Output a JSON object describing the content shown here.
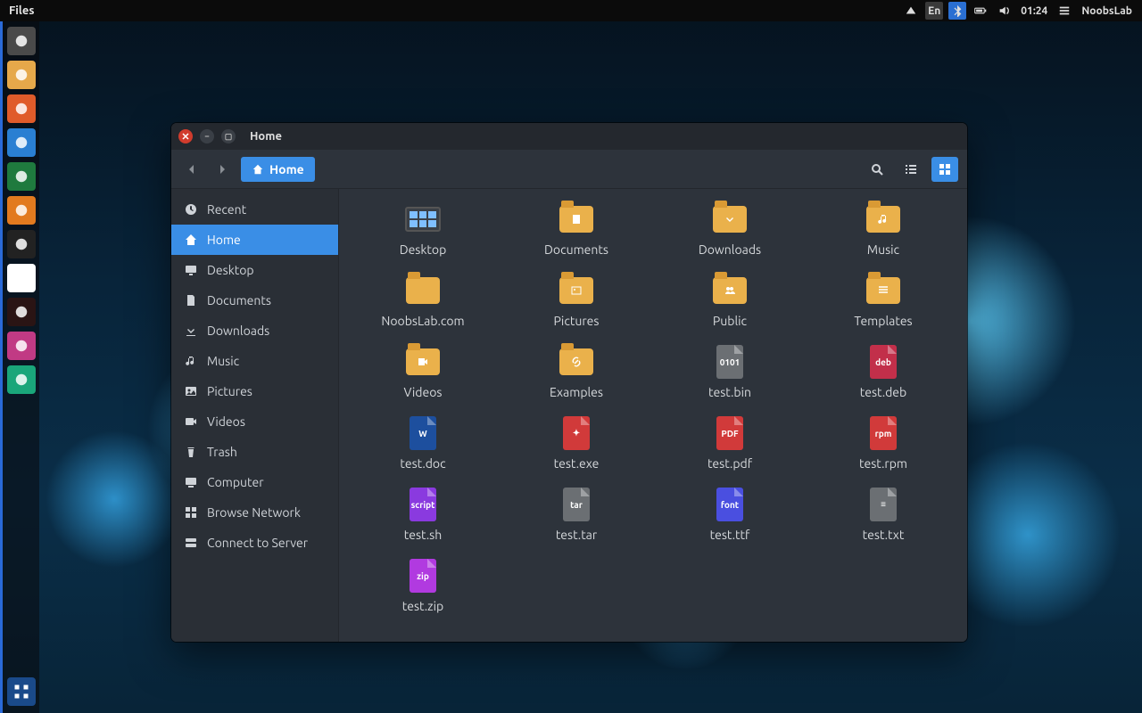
{
  "panel": {
    "app_label": "Files",
    "clock": "01:24",
    "lang": "En",
    "user_label": "NoobsLab"
  },
  "launchers": [
    {
      "name": "ubuntu-logo",
      "bg": "#4a4a4a"
    },
    {
      "name": "files-icon",
      "bg": "#e6a84a"
    },
    {
      "name": "firefox-icon",
      "bg": "#e05b2a"
    },
    {
      "name": "software-icon",
      "bg": "#2a7fd2"
    },
    {
      "name": "calendar-icon",
      "bg": "#1f7a3e"
    },
    {
      "name": "charts-icon",
      "bg": "#e27a1f"
    },
    {
      "name": "updater-icon",
      "bg": "#222"
    },
    {
      "name": "amazon-icon",
      "bg": "#fff"
    },
    {
      "name": "record-icon",
      "bg": "#2a1414"
    },
    {
      "name": "settings-icon",
      "bg": "#c13a84"
    },
    {
      "name": "shield-icon",
      "bg": "#1aa67a"
    }
  ],
  "window": {
    "title": "Home",
    "path_label": "Home",
    "sidebar": [
      {
        "icon": "clock",
        "label": "Recent"
      },
      {
        "icon": "home",
        "label": "Home",
        "active": true
      },
      {
        "icon": "desktop",
        "label": "Desktop"
      },
      {
        "icon": "docs",
        "label": "Documents"
      },
      {
        "icon": "download",
        "label": "Downloads"
      },
      {
        "icon": "music",
        "label": "Music"
      },
      {
        "icon": "pictures",
        "label": "Pictures"
      },
      {
        "icon": "videos",
        "label": "Videos"
      },
      {
        "icon": "trash",
        "label": "Trash"
      },
      {
        "icon": "computer",
        "label": "Computer"
      },
      {
        "icon": "network",
        "label": "Browse Network"
      },
      {
        "icon": "server",
        "label": "Connect to Server"
      }
    ],
    "files": [
      {
        "name": "Desktop",
        "kind": "desktop"
      },
      {
        "name": "Documents",
        "kind": "folder",
        "sym": "docs"
      },
      {
        "name": "Downloads",
        "kind": "folder",
        "sym": "download"
      },
      {
        "name": "Music",
        "kind": "folder",
        "sym": "music"
      },
      {
        "name": "NoobsLab.com",
        "kind": "folder"
      },
      {
        "name": "Pictures",
        "kind": "folder",
        "sym": "pictures"
      },
      {
        "name": "Public",
        "kind": "folder",
        "sym": "public"
      },
      {
        "name": "Templates",
        "kind": "folder",
        "sym": "templates"
      },
      {
        "name": "Videos",
        "kind": "folder",
        "sym": "videos"
      },
      {
        "name": "Examples",
        "kind": "folder",
        "sym": "link"
      },
      {
        "name": "test.bin",
        "kind": "file",
        "bg": "#6b6f73",
        "tag": "0101"
      },
      {
        "name": "test.deb",
        "kind": "file",
        "bg": "#c22f4a",
        "tag": "deb"
      },
      {
        "name": "test.doc",
        "kind": "file",
        "bg": "#1d4f9e",
        "tag": "W"
      },
      {
        "name": "test.exe",
        "kind": "file",
        "bg": "#d13a3a",
        "tag": "✦"
      },
      {
        "name": "test.pdf",
        "kind": "file",
        "bg": "#d13a3a",
        "tag": "PDF"
      },
      {
        "name": "test.rpm",
        "kind": "file",
        "bg": "#d13a3a",
        "tag": "rpm"
      },
      {
        "name": "test.sh",
        "kind": "file",
        "bg": "#8a3adf",
        "tag": "script"
      },
      {
        "name": "test.tar",
        "kind": "file",
        "bg": "#6b6f73",
        "tag": "tar"
      },
      {
        "name": "test.ttf",
        "kind": "file",
        "bg": "#4a4fe0",
        "tag": "font"
      },
      {
        "name": "test.txt",
        "kind": "file",
        "bg": "#6b6f73",
        "tag": "≡"
      },
      {
        "name": "test.zip",
        "kind": "file",
        "bg": "#b13ae0",
        "tag": "zip"
      }
    ]
  }
}
